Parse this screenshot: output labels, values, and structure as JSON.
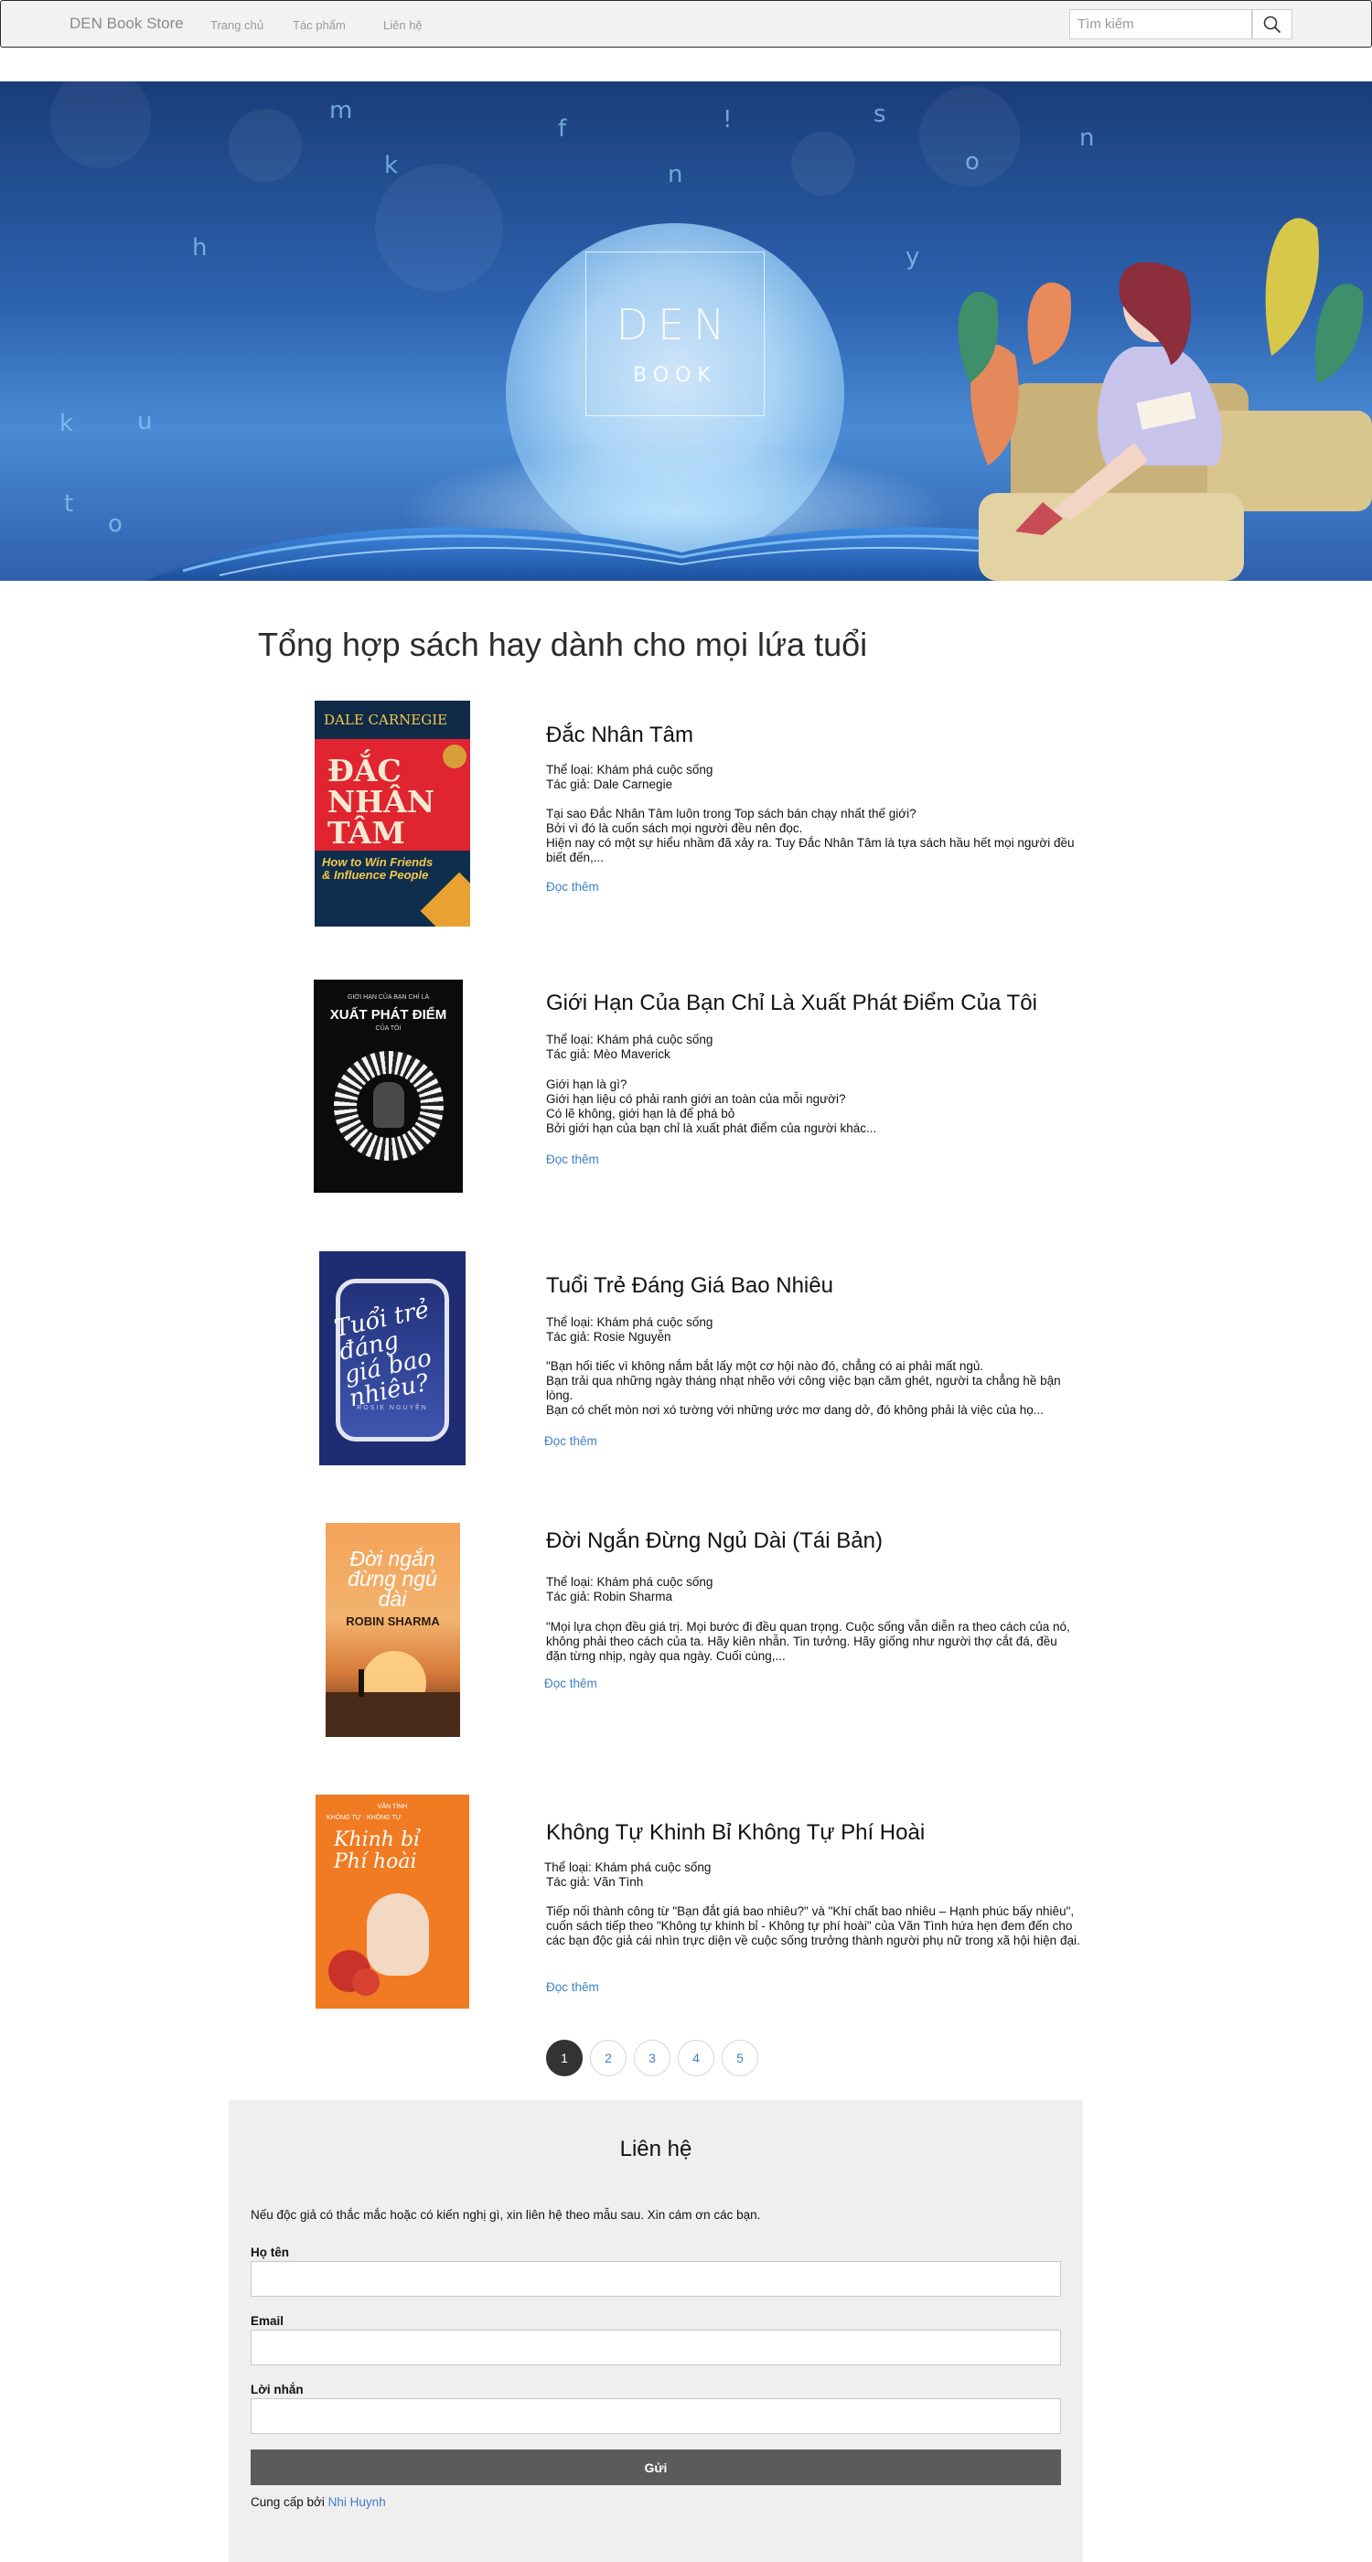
{
  "navbar": {
    "brand": "DEN Book Store",
    "links": [
      "Trang chủ",
      "Tác phẩm",
      "Liên hệ"
    ],
    "search_placeholder": "Tìm kiếm"
  },
  "hero": {
    "logo_line1": "DEN",
    "logo_line2": "BOOK"
  },
  "main": {
    "heading": "Tổng hợp sách hay dành cho mọi lứa tuổi",
    "read_more": "Đọc thêm",
    "books": [
      {
        "title": "Đắc Nhân Tâm",
        "genre": "Thể loại: Khám phá cuộc sống",
        "author": "Tác giả: Dale Carnegie",
        "desc": [
          "Tại sao Đắc Nhân Tâm luôn trong Top sách bán chạy nhất thế giới?",
          "Bởi vì đó là cuốn sách mọi người đều nên đọc.",
          "Hiện nay có một sự hiểu nhầm đã xảy ra. Tuy Đắc Nhân Tâm là tựa sách hầu hết mọi người đều biết đến,..."
        ],
        "cover": {
          "top_text": "DALE CARNEGIE",
          "title": "ĐẮC NHÂN TÂM",
          "subtitle": "How to Win Friends & Influence People"
        }
      },
      {
        "title": "Giới Hạn Của Bạn Chỉ Là Xuất Phát Điểm Của Tôi",
        "genre": "Thể loại: Khám phá cuộc sống",
        "author": "Tác giả: Mèo Maverick",
        "desc": [
          "Giới hạn là gì?",
          "Giới hạn liệu có phải ranh giới an toàn của mỗi người?",
          "Có lẽ không, giới hạn là để phá bỏ",
          "Bởi giới hạn của bạn chỉ là xuất phát điểm của người khác..."
        ],
        "cover": {
          "top_text": "GIỚI HẠN CỦA BẠN CHỈ LÀ",
          "title": "XUẤT PHÁT ĐIỂM",
          "subtitle": "CỦA TÔI"
        }
      },
      {
        "title": "Tuổi Trẻ Đáng Giá Bao Nhiêu",
        "genre": "Thể loại: Khám phá cuộc sống",
        "author": "Tác giả: Rosie Nguyễn",
        "desc": [
          "\"Bạn hối tiếc vì không nắm bắt lấy một cơ hội nào đó, chẳng có ai phải mất ngủ.",
          "Bạn trải qua những ngày tháng nhạt nhẽo với công việc bạn căm ghét, người ta chẳng hề bận lòng.",
          "Bạn có chết mòn nơi xó tường với những ước mơ dang dở, đó không phải là việc của họ..."
        ],
        "cover": {
          "top_text": "",
          "title": "Tuổi trẻ đáng giá bao nhiêu?",
          "subtitle": "ROSIE NGUYỄN"
        }
      },
      {
        "title": "Đời Ngắn Đừng Ngủ Dài (Tái Bản)",
        "genre": "Thể loại: Khám phá cuộc sống",
        "author": "Tác giả: Robin Sharma",
        "desc": [
          "\"Mọi lựa chọn đều giá trị. Mọi bước đi đều quan trọng. Cuộc sống vẫn diễn ra theo cách của nó, không phải theo cách của ta. Hãy kiên nhẫn. Tin tưởng. Hãy giống như người thợ cắt đá, đều đặn từng nhịp, ngày qua ngày. Cuối cùng,..."
        ],
        "cover": {
          "top_text": "",
          "title": "Đời ngắn đừng ngủ dài",
          "subtitle": "ROBIN SHARMA"
        }
      },
      {
        "title": "Không Tự Khinh Bỉ Không Tự Phí Hoài",
        "genre": "Thể loại: Khám phá cuộc sống",
        "author": "Tác giả: Vãn Tình",
        "desc": [
          "Tiếp nối thành công từ \"Bạn đắt giá bao nhiêu?\" và \"Khí chất bao nhiêu – Hạnh phúc bấy nhiêu\", cuốn sách tiếp theo \"Không tự khinh bỉ - Không tự phí hoài\" của Vãn Tình hứa hẹn đem đến cho các bạn độc giả cái nhìn trực diện về cuộc sống trưởng thành người phụ nữ trong xã hội hiện đại."
        ],
        "cover": {
          "top_text": "VÃN TÌNH",
          "title": "Khinh bỉ Phí hoài",
          "subtitle": "KHÔNG TỰ · KHÔNG TỰ"
        }
      }
    ]
  },
  "pagination": {
    "pages": [
      "1",
      "2",
      "3",
      "4",
      "5"
    ],
    "active": "1"
  },
  "contact": {
    "title": "Liên hệ",
    "intro": "Nếu độc giả có thắc mắc hoặc có kiến nghị gì, xin liên hệ theo mẫu sau. Xin cám ơn các bạn.",
    "name_label": "Họ tên",
    "email_label": "Email",
    "message_label": "Lời nhắn",
    "send_label": "Gửi",
    "credit_prefix": "Cung cấp bởi",
    "credit_name": "Nhi Huynh"
  },
  "colors": {
    "accent_link": "#3d7fc6",
    "send_button": "#5b5b5b",
    "active_page": "#333333"
  }
}
